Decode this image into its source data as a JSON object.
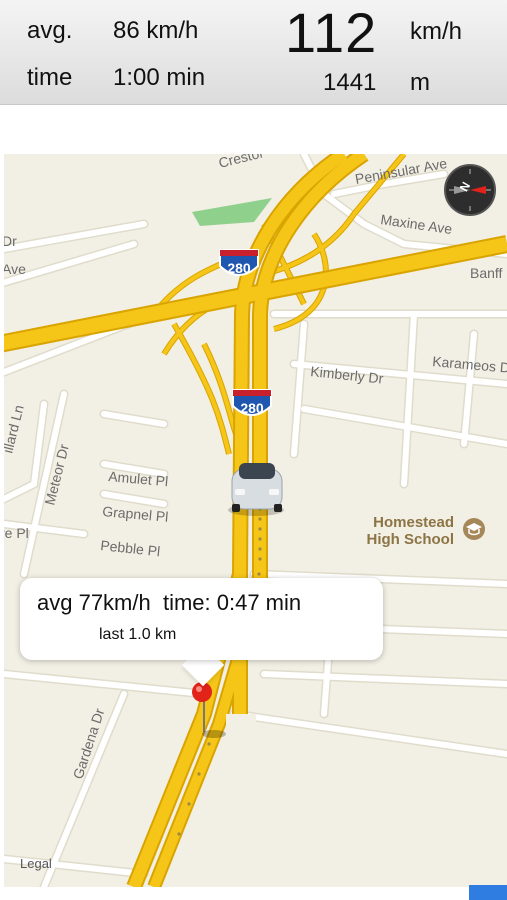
{
  "stats": {
    "avg_label": "avg.",
    "avg_value": "86 km/h",
    "time_label": "time",
    "time_value": "1:00 min",
    "speed_value": "112",
    "speed_unit": "km/h",
    "distance_value": "1441",
    "distance_unit": "m"
  },
  "map": {
    "streets": {
      "creston": "Crestor",
      "peninsular": "Peninsular Ave",
      "maxine": "Maxine Ave",
      "banff": "Banff",
      "karameos": "Karameos D",
      "kimberly": "Kimberly Dr",
      "dr_left": "Dr",
      "ave_left": "Ave",
      "millard": "illard Ln",
      "meteor": "Meteor Dr",
      "amulet": "Amulet Pl",
      "grapnel": "Grapnel Pl",
      "pebble": "Pebble Pl",
      "pl_left": "re Pl",
      "gardena": "Gardena Dr"
    },
    "shields": [
      "280",
      "280"
    ],
    "poi": {
      "line1": "Homestead",
      "line2": "High School"
    },
    "legal": "Legal",
    "compass_letter": "N"
  },
  "popup": {
    "title": "avg 77km/h  time: 0:47 min",
    "subtitle": "last 1.0 km"
  },
  "colors": {
    "highway": "#f5c518",
    "highway_edge": "#d9a400",
    "road": "#ffffff",
    "road_edge": "#e0dccc",
    "park": "#8fd18c",
    "map_bg": "#f2efe4",
    "pin": "#e2231a"
  }
}
